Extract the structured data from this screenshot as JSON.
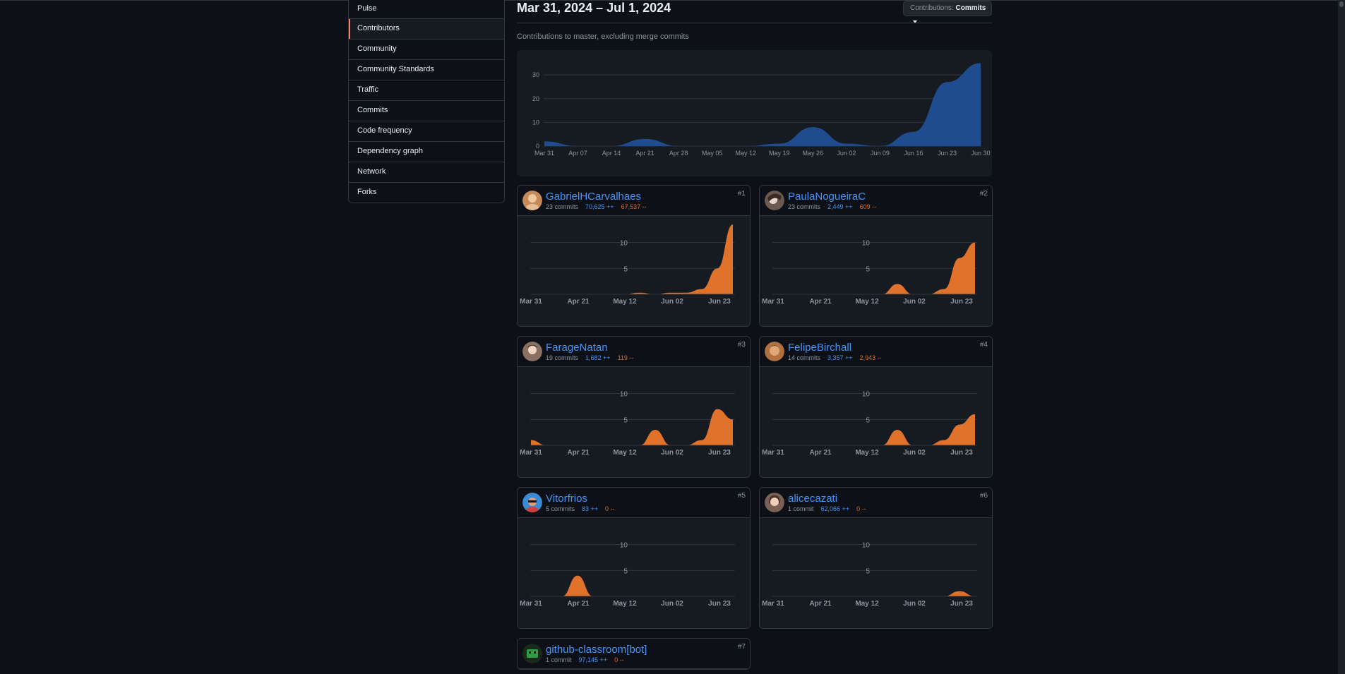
{
  "sidebar": {
    "items": [
      {
        "label": "Pulse"
      },
      {
        "label": "Contributors",
        "selected": true
      },
      {
        "label": "Community"
      },
      {
        "label": "Community Standards"
      },
      {
        "label": "Traffic"
      },
      {
        "label": "Commits"
      },
      {
        "label": "Code frequency"
      },
      {
        "label": "Dependency graph"
      },
      {
        "label": "Network"
      },
      {
        "label": "Forks"
      }
    ]
  },
  "header": {
    "date_range": "Mar 31, 2024 – Jul 1, 2024",
    "contrib_prefix": "Contributions:",
    "contrib_value": "Commits",
    "subtitle": "Contributions to master, excluding merge commits"
  },
  "colors": {
    "main_area": "#1f4c8f",
    "user_area": "#e1722b",
    "link": "#4493f8",
    "deletions": "#db6d28"
  },
  "chart_data": [
    {
      "type": "area",
      "x": [
        "Mar 31",
        "Apr 07",
        "Apr 14",
        "Apr 21",
        "Apr 28",
        "May 05",
        "May 12",
        "May 19",
        "May 26",
        "Jun 02",
        "Jun 09",
        "Jun 16",
        "Jun 23",
        "Jun 30"
      ],
      "values": [
        2,
        0,
        0,
        3,
        0,
        0,
        0,
        1,
        8,
        1,
        0,
        6,
        27,
        35
      ],
      "yticks": [
        0,
        10,
        20,
        30
      ],
      "ylim": [
        0,
        36
      ]
    },
    {
      "type": "area",
      "x": [
        "Mar 31",
        "Apr 21",
        "May 12",
        "Jun 02",
        "Jun 23"
      ],
      "values": [
        0,
        0,
        0,
        0,
        0,
        0,
        0,
        0.3,
        0,
        0.3,
        0.3,
        1,
        5,
        13.5
      ],
      "yticks": [
        5,
        10
      ],
      "ylim": [
        0,
        13.5
      ]
    },
    {
      "type": "area",
      "x": [
        "Mar 31",
        "Apr 21",
        "May 12",
        "Jun 02",
        "Jun 23"
      ],
      "values": [
        0,
        0,
        0,
        0,
        0,
        0,
        0,
        0,
        2,
        0,
        0,
        1,
        7,
        10
      ],
      "yticks": [
        5,
        10
      ],
      "ylim": [
        0,
        13.5
      ]
    },
    {
      "type": "area",
      "x": [
        "Mar 31",
        "Apr 21",
        "May 12",
        "Jun 02",
        "Jun 23"
      ],
      "values": [
        1,
        0,
        0,
        0,
        0,
        0,
        0,
        0,
        3,
        0,
        0,
        1,
        7,
        5
      ],
      "yticks": [
        5,
        10
      ],
      "ylim": [
        0,
        13.5
      ]
    },
    {
      "type": "area",
      "x": [
        "Mar 31",
        "Apr 21",
        "May 12",
        "Jun 02",
        "Jun 23"
      ],
      "values": [
        0,
        0,
        0,
        0,
        0,
        0,
        0,
        0,
        3,
        0,
        0,
        1,
        4,
        6
      ],
      "yticks": [
        5,
        10
      ],
      "ylim": [
        0,
        13.5
      ]
    },
    {
      "type": "area",
      "x": [
        "Mar 31",
        "Apr 21",
        "May 12",
        "Jun 02",
        "Jun 23"
      ],
      "values": [
        0,
        0,
        0,
        4,
        0,
        0,
        0,
        0,
        0,
        0,
        0,
        0,
        0,
        0
      ],
      "yticks": [
        5,
        10
      ],
      "ylim": [
        0,
        13.5
      ]
    },
    {
      "type": "area",
      "x": [
        "Mar 31",
        "Apr 21",
        "May 12",
        "Jun 02",
        "Jun 23"
      ],
      "values": [
        0,
        0,
        0,
        0,
        0,
        0,
        0,
        0,
        0,
        0,
        0,
        0,
        1,
        0
      ],
      "yticks": [
        5,
        10
      ],
      "ylim": [
        0,
        13.5
      ]
    }
  ],
  "contributors": [
    {
      "name": "GabrielHCarvalhaes",
      "rank": "#1",
      "commits": "23 commits",
      "additions": "70,625 ++",
      "deletions": "67,537 --",
      "avatar_color": "#c48a5a"
    },
    {
      "name": "PaulaNogueiraC",
      "rank": "#2",
      "commits": "23 commits",
      "additions": "2,449 ++",
      "deletions": "609 --",
      "avatar_color": "#6b5a52"
    },
    {
      "name": "FarageNatan",
      "rank": "#3",
      "commits": "19 commits",
      "additions": "1,682 ++",
      "deletions": "119 --",
      "avatar_color": "#8a7060"
    },
    {
      "name": "FelipeBirchall",
      "rank": "#4",
      "commits": "14 commits",
      "additions": "3,357 ++",
      "deletions": "2,943 --",
      "avatar_color": "#b07040"
    },
    {
      "name": "Vitorfrios",
      "rank": "#5",
      "commits": "5 commits",
      "additions": "83 ++",
      "deletions": "0 --",
      "avatar_color": "#3a8ad6"
    },
    {
      "name": "alicecazati",
      "rank": "#6",
      "commits": "1 commit",
      "additions": "62,066 ++",
      "deletions": "0 --",
      "avatar_color": "#7a6055"
    },
    {
      "name": "github-classroom[bot]",
      "rank": "#7",
      "commits": "1 commit",
      "additions": "97,145 ++",
      "deletions": "0 --",
      "avatar_color": "#2ea043"
    }
  ]
}
